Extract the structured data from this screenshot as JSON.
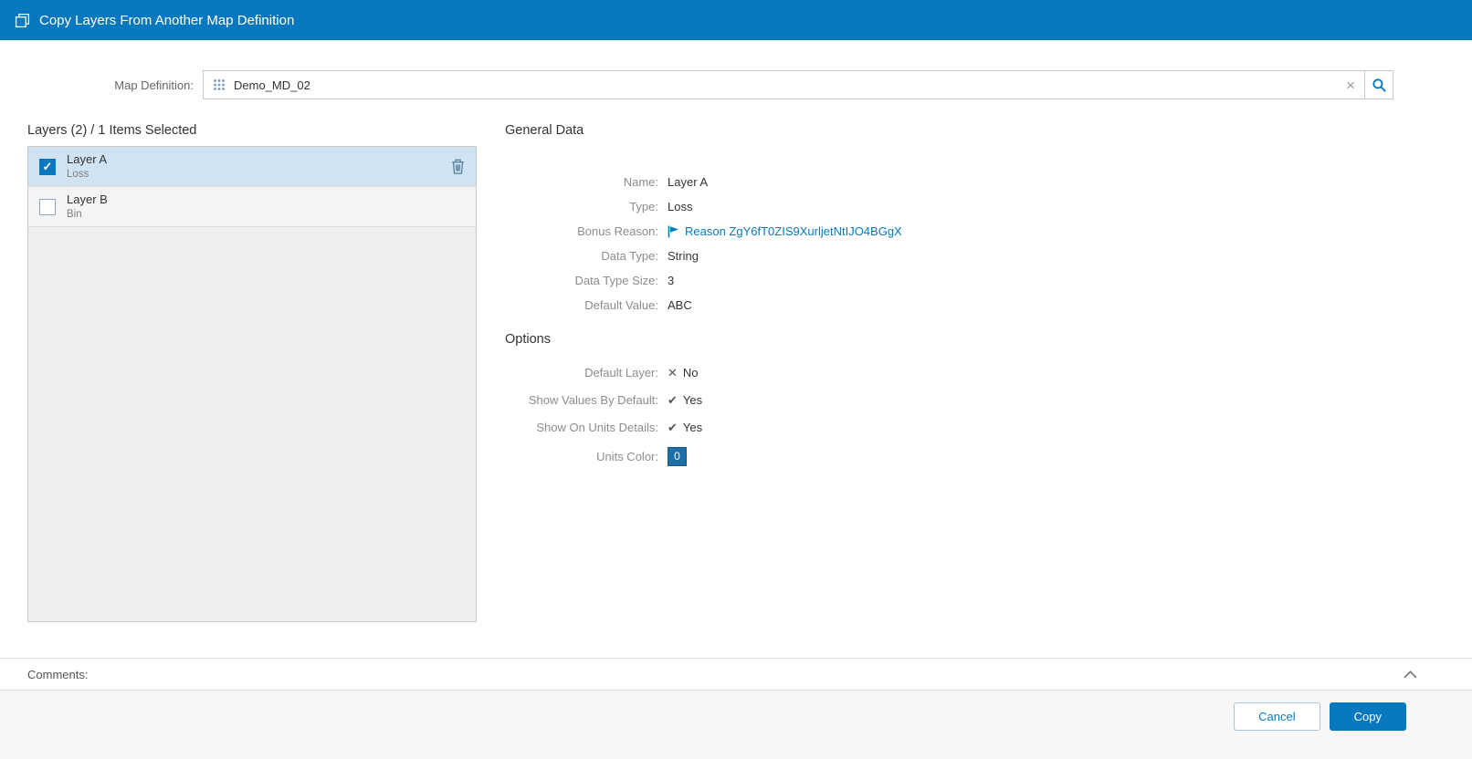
{
  "titlebar": {
    "title": "Copy Layers From Another Map Definition"
  },
  "map_definition": {
    "label": "Map Definition:",
    "value": "Demo_MD_02",
    "clear_glyph": "×"
  },
  "layers_panel": {
    "header": "Layers (2) / 1 Items Selected",
    "items": [
      {
        "name": "Layer A",
        "type": "Loss",
        "checked": true
      },
      {
        "name": "Layer B",
        "type": "Bin",
        "checked": false
      }
    ]
  },
  "general_data": {
    "header": "General Data",
    "fields": [
      {
        "label": "Name:",
        "value": "Layer A"
      },
      {
        "label": "Type:",
        "value": "Loss"
      },
      {
        "label": "Bonus Reason:",
        "value": "Reason ZgY6fT0ZIS9XurljetNtIJO4BGgX"
      },
      {
        "label": "Data Type:",
        "value": "String"
      },
      {
        "label": "Data Type Size:",
        "value": "3"
      },
      {
        "label": "Default Value:",
        "value": "ABC"
      }
    ],
    "options_header": "Options",
    "options": [
      {
        "label": "Default Layer:",
        "glyph": "✕",
        "value": "No"
      },
      {
        "label": "Show Values By Default:",
        "glyph": "✔",
        "value": "Yes"
      },
      {
        "label": "Show On Units Details:",
        "glyph": "✔",
        "value": "Yes"
      },
      {
        "label": "Units Color:",
        "value": "0"
      }
    ]
  },
  "comments": {
    "label": "Comments:"
  },
  "footer": {
    "cancel_label": "Cancel",
    "copy_label": "Copy"
  },
  "colors": {
    "accent": "#0878BE",
    "selected_row": "#CFE3F2",
    "link": "#0878BE",
    "units_color_chip": "#1D6FA5"
  }
}
